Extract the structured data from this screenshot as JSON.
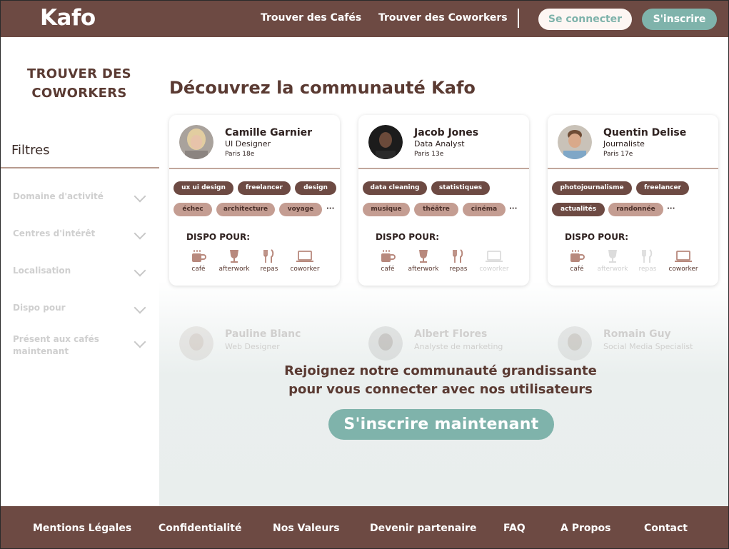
{
  "header": {
    "logo": "Kafo",
    "nav": [
      "Trouver des Cafés",
      "Trouver des Coworkers"
    ],
    "login_label": "Se connecter",
    "signup_label": "S'inscrire"
  },
  "sidebar": {
    "title_line1": "TROUVER DES",
    "title_line2": "COWORKERS",
    "filters_title": "Filtres",
    "filters": [
      "Domaine d'activité",
      "Centres d'intérêt",
      "Localisation",
      "Dispo pour",
      "Présent aux cafés maintenant"
    ]
  },
  "main": {
    "title": "Découvrez la communauté Kafo",
    "dispo_title": "DISPO POUR:",
    "dispo_labels": [
      "café",
      "afterwork",
      "repas",
      "coworker"
    ],
    "more": "···",
    "cards": [
      {
        "name": "Camille Garnier",
        "role": "UI Designer",
        "location": "Paris 18e",
        "tags_row1": [
          "ux ui design",
          "freelancer",
          "design"
        ],
        "tags_row2": [
          "échec",
          "architecture",
          "voyage"
        ],
        "dispo": [
          true,
          true,
          true,
          true
        ]
      },
      {
        "name": "Jacob Jones",
        "role": "Data Analyst",
        "location": "Paris 13e",
        "tags_row1": [
          "data cleaning",
          "statistiques"
        ],
        "tags_row2": [
          "musique",
          "théâtre",
          "cinéma"
        ],
        "dispo": [
          true,
          true,
          true,
          false
        ]
      },
      {
        "name": "Quentin Delise",
        "role": "Journaliste",
        "location": "Paris 17e",
        "tags_row1": [
          "photojournalisme",
          "freelancer"
        ],
        "tags_row2": [
          "actualités",
          "randonnée"
        ],
        "dispo": [
          true,
          false,
          false,
          true
        ]
      }
    ],
    "ghost_cards": [
      {
        "name": "Pauline Blanc",
        "role": "Web Designer"
      },
      {
        "name": "Albert Flores",
        "role": "Analyste de marketing"
      },
      {
        "name": "Romain Guy",
        "role": "Social Media Specialist"
      }
    ],
    "join_line1": "Rejoignez notre communauté grandissante",
    "join_line2": "pour vous connecter avec nos utilisateurs",
    "cta_label": "S'inscrire maintenant"
  },
  "footer": {
    "links": [
      "Mentions Légales",
      "Confidentialité",
      "Nos Valeurs",
      "Devenir partenaire",
      "FAQ",
      "A Propos",
      "Contact"
    ]
  },
  "colors": {
    "brand_brown": "#6d4a43",
    "accent_teal": "#7fb3ab",
    "tag_light": "#c49d92"
  }
}
